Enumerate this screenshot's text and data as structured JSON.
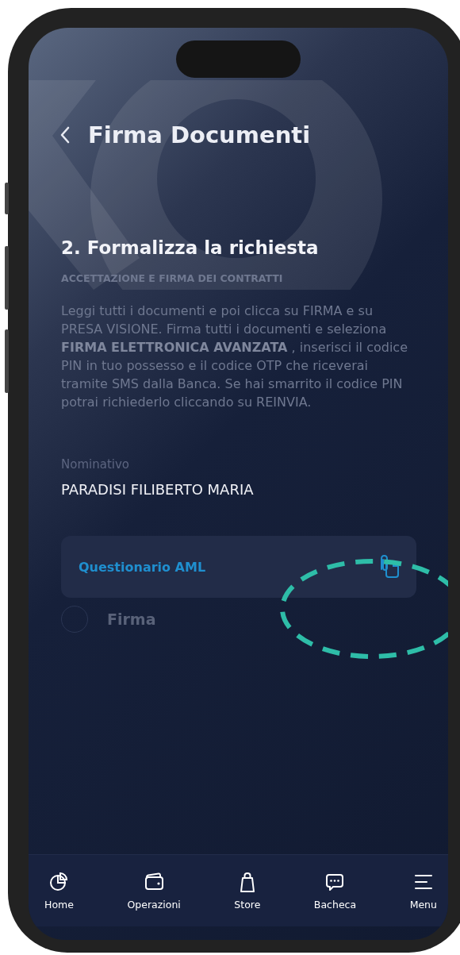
{
  "header": {
    "title": "Firma Documenti"
  },
  "step": {
    "title": "2. Formalizza la richiesta",
    "subtitle": "ACCETTAZIONE E FIRMA DEI CONTRATTI",
    "description": "Leggi tutti i documenti e poi clicca su FIRMA e su PRESA VISIONE. Firma tutti i documenti e seleziona **FIRMA ELETTRONICA AVANZATA** , inserisci il codice PIN in tuo possesso e il codice OTP che riceverai tramite SMS dalla Banca. Se hai smarrito il codice PIN potrai richiederlo cliccando su REINVIA."
  },
  "holder": {
    "label": "Nominativo",
    "value": "PARADISI FILIBERTO MARIA"
  },
  "documents": [
    {
      "label": "Questionario AML"
    }
  ],
  "signature": {
    "label": "Firma",
    "checked": false
  },
  "nav": [
    {
      "kind": "home",
      "label": "Home"
    },
    {
      "kind": "operations",
      "label": "Operazioni"
    },
    {
      "kind": "store",
      "label": "Store"
    },
    {
      "kind": "board",
      "label": "Bacheca"
    },
    {
      "kind": "menu",
      "label": "Menu"
    }
  ]
}
